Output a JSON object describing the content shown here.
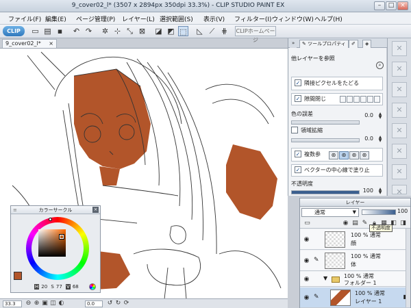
{
  "window": {
    "title": "9_cover02_l* (3507 x 2894px 350dpi 33.3%) - CLIP STUDIO PAINT EX",
    "min_glyph": "–",
    "max_glyph": "□",
    "close_glyph": "×"
  },
  "menu": [
    "ファイル(F)",
    "編集(E)",
    "ページ管理(P)",
    "レイヤー(L)",
    "選択範囲(S)",
    "表示(V)",
    "フィルター(I)",
    "ウィンドウ(W)",
    "ヘルプ(H)"
  ],
  "toolbar": {
    "clip_label": "CLIP",
    "home_label": "CLIPホームページ"
  },
  "document_tab": {
    "label": "9_cover02_l*",
    "close": "×"
  },
  "tool_property": {
    "tab_label": "ツールプロパティ",
    "ref_label": "他レイヤーを参照",
    "adjacent_pixel": "隣接ピクセルをたどる",
    "gap_close": "隙間閉じ",
    "color_margin": "色の誤差",
    "color_margin_value": "0.0",
    "area_scaling": "領域拡縮",
    "area_scaling_value": "0.0",
    "multi_ref": "複数参",
    "vector_center": "ベクターの中心線で塗り止",
    "opacity_label": "不透明度",
    "opacity_value": "100"
  },
  "color_circle": {
    "title": "カラーサークル",
    "h_label": "H",
    "h_value": "20",
    "s_label": "S",
    "s_value": "77",
    "v_label": "V",
    "v_value": "68",
    "main_color": "#b2552a"
  },
  "status": {
    "zoom": "33.3",
    "angle": "0.0"
  },
  "layers": {
    "title": "レイヤー",
    "blend_mode": "通常",
    "opacity": "100",
    "tooltip": "不透明度",
    "rows": [
      {
        "op": "100 % 通常",
        "name": "顔"
      },
      {
        "op": "100 % 通常",
        "name": "体"
      },
      {
        "op": "100 % 通常",
        "name": "フォルダー 1"
      },
      {
        "op": "100 % 通常",
        "name": "レイヤー 1"
      }
    ]
  },
  "colors": {
    "skin_fill": "#b2552a",
    "accent": "#2f78bd"
  }
}
